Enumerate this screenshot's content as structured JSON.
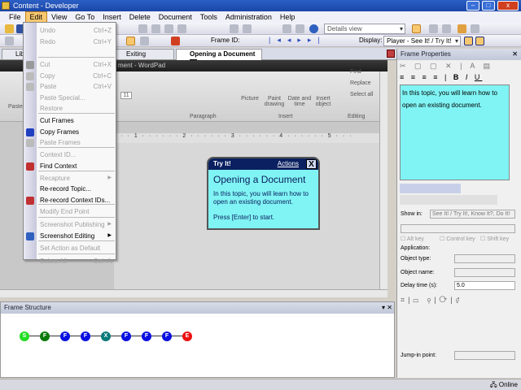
{
  "window": {
    "title": "Content - Developer",
    "min": "–",
    "max": "□",
    "close": "x"
  },
  "menubar": [
    "File",
    "Edit",
    "View",
    "Go To",
    "Insert",
    "Delete",
    "Document",
    "Tools",
    "Administration",
    "Help"
  ],
  "toolbar": {
    "view_combo": "Details view",
    "frame_id_label": "Frame ID:",
    "display_label": "Display:",
    "display_combo": "Player - See It! / Try It!"
  },
  "tabs": [
    "Libr",
    "Exiting WordPad",
    "Opening a Document"
  ],
  "tab_close": "X",
  "screenshot": {
    "window_title": "ment - WordPad",
    "font_size": "11",
    "groups": [
      "Paragraph",
      "Insert",
      "Editing"
    ],
    "insert_buttons": [
      "Picture",
      "Paint drawing",
      "Date and time",
      "Insert object"
    ],
    "editing_buttons": [
      "Find",
      "Replace",
      "Select all"
    ],
    "paste": "Paste",
    "ruler": "· · · 1 · · · · · · 2 · · · · · · 3 · · · · · · 4 · · · · · · 5 · · ·"
  },
  "bubble": {
    "mode": "Try It!",
    "actions": "Actions",
    "close": "X",
    "title": "Opening a Document",
    "body": "In this topic, you will learn how to open an existing document.",
    "press": "Press [Enter] to start."
  },
  "frame_structure": {
    "title": "Frame Structure",
    "nodes": [
      {
        "label": "S",
        "color": "#22dd22"
      },
      {
        "label": "F",
        "color": "#0a7a0a"
      },
      {
        "label": "F",
        "color": "#0a10e0"
      },
      {
        "label": "F",
        "color": "#0a10e0"
      },
      {
        "label": "X",
        "color": "#0a7a7a"
      },
      {
        "label": "F",
        "color": "#0a10e0"
      },
      {
        "label": "F",
        "color": "#0a10e0"
      },
      {
        "label": "F",
        "color": "#0a10e0"
      },
      {
        "label": "E",
        "color": "#ee1010"
      }
    ]
  },
  "frame_properties": {
    "title": "Frame Properties",
    "text": "In this topic, you will learn how to open an existing document.",
    "show_in_label": "Show in:",
    "show_in_value": "See It! / Try It!, Know It?, Do It!",
    "alt_key": "Alt key",
    "control_key": "Control key",
    "shift_key": "Shift key",
    "application": "Application:",
    "object_type": "Object type:",
    "object_name": "Object name:",
    "delay_label": "Delay time (s):",
    "delay_value": "5.0",
    "jump_in": "Jump-in point:"
  },
  "edit_menu": [
    {
      "label": "Undo",
      "shortcut": "Ctrl+Z",
      "enabled": false
    },
    {
      "label": "Redo",
      "shortcut": "Ctrl+Y",
      "enabled": false
    },
    {
      "label": "Cut",
      "shortcut": "Ctrl+X",
      "enabled": false
    },
    {
      "label": "Copy",
      "shortcut": "Ctrl+C",
      "enabled": false
    },
    {
      "label": "Paste",
      "shortcut": "Ctrl+V",
      "enabled": false
    },
    {
      "label": "Paste Special...",
      "enabled": false
    },
    {
      "label": "Restore",
      "enabled": false
    },
    {
      "label": "Cut Frames",
      "enabled": true
    },
    {
      "label": "Copy Frames",
      "enabled": true
    },
    {
      "label": "Paste Frames",
      "enabled": false
    },
    {
      "label": "Context ID...",
      "enabled": false
    },
    {
      "label": "Find Context",
      "enabled": true
    },
    {
      "label": "Recapture",
      "enabled": false,
      "submenu": true
    },
    {
      "label": "Re-record Topic...",
      "enabled": true
    },
    {
      "label": "Re-record Context IDs...",
      "enabled": true
    },
    {
      "label": "Modify End Point",
      "enabled": false
    },
    {
      "label": "Screenshot Publishing",
      "enabled": false,
      "submenu": true
    },
    {
      "label": "Screenshot Editing",
      "enabled": true,
      "submenu": true
    },
    {
      "label": "Set Action as Default",
      "enabled": false
    },
    {
      "label": "Select All",
      "shortcut": "Ctrl+A",
      "enabled": false
    }
  ],
  "status": {
    "online": "Online"
  }
}
